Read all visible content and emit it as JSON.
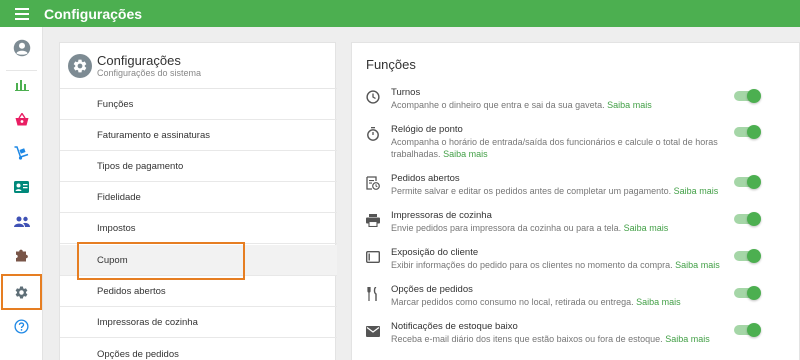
{
  "app": {
    "title": "Configurações"
  },
  "rail": {
    "items": [
      {
        "name": "account-icon",
        "color": "#7d8b93"
      },
      {
        "name": "bar-chart-icon",
        "color": "#4caf50"
      },
      {
        "name": "shopping-basket-icon",
        "color": "#e91e63"
      },
      {
        "name": "dolly-icon",
        "color": "#1e88e5"
      },
      {
        "name": "contact-card-icon",
        "color": "#00897b"
      },
      {
        "name": "people-icon",
        "color": "#3f51b5"
      },
      {
        "name": "puzzle-icon",
        "color": "#795548"
      },
      {
        "name": "gear-icon",
        "color": "#7d8b93",
        "selected": true
      },
      {
        "name": "help-icon",
        "color": "#1e88e5"
      }
    ]
  },
  "settings": {
    "title": "Configurações",
    "subtitle": "Configurações do sistema",
    "items": [
      {
        "label": "Funções"
      },
      {
        "label": "Faturamento e assinaturas"
      },
      {
        "label": "Tipos de pagamento"
      },
      {
        "label": "Fidelidade"
      },
      {
        "label": "Impostos"
      },
      {
        "label": "Cupom",
        "active": true
      },
      {
        "label": "Pedidos abertos"
      },
      {
        "label": "Impressoras de cozinha"
      },
      {
        "label": "Opções de pedidos"
      }
    ]
  },
  "features": {
    "title": "Funções",
    "link_label": "Saiba mais",
    "items": [
      {
        "icon": "clock-icon",
        "title": "Turnos",
        "description": "Acompanhe o dinheiro que entra e sai da sua gaveta.",
        "enabled": true
      },
      {
        "icon": "stopwatch-icon",
        "title": "Relógio de ponto",
        "description": "Acompanha o horário de entrada/saída dos funcionários e calcule o total de horas trabalhadas.",
        "enabled": true
      },
      {
        "icon": "open-orders-icon",
        "title": "Pedidos abertos",
        "description": "Permite salvar e editar os pedidos antes de completar um pagamento.",
        "enabled": true
      },
      {
        "icon": "printer-icon",
        "title": "Impressoras de cozinha",
        "description": "Envie pedidos para impressora da cozinha ou para a tela.",
        "enabled": true
      },
      {
        "icon": "customer-display-icon",
        "title": "Exposição do cliente",
        "description": "Exibir informações do pedido para os clientes no momento da compra.",
        "enabled": true
      },
      {
        "icon": "cutlery-icon",
        "title": "Opções de pedidos",
        "description": "Marcar pedidos como consumo no local, retirada ou entrega.",
        "enabled": true
      },
      {
        "icon": "mail-icon",
        "title": "Notificações de estoque baixo",
        "description": "Receba e-mail diário dos itens que estão baixos ou fora de estoque.",
        "enabled": true
      }
    ]
  }
}
